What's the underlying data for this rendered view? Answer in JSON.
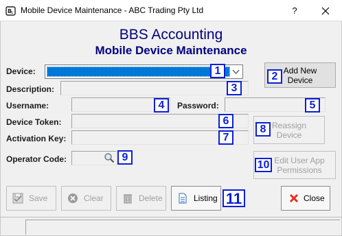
{
  "window": {
    "title": "Mobile Device Maintenance - ABC Trading Pty Ltd",
    "help_glyph": "?",
    "app_icon": "bbs-logo-icon"
  },
  "header": {
    "title": "BBS Accounting",
    "subtitle": "Mobile Device Maintenance"
  },
  "form": {
    "device_label": "Device:",
    "description_label": "Description:",
    "username_label": "Username:",
    "password_label": "Password:",
    "device_token_label": "Device Token:",
    "activation_key_label": "Activation Key:",
    "operator_code_label": "Operator Code:"
  },
  "buttons": {
    "add_new_device": "Add New Device",
    "reassign_device": "Reassign Device",
    "edit_user_app_permissions": "Edit User App Permissions"
  },
  "toolbar": {
    "save": "Save",
    "clear": "Clear",
    "delete": "Delete",
    "listing": "Listing",
    "close": "Close"
  },
  "callouts": [
    "1",
    "2",
    "3",
    "4",
    "5",
    "6",
    "7",
    "8",
    "9",
    "10",
    "11"
  ],
  "colors": {
    "heading": "#000080",
    "selection": "#0078d7",
    "callout": "#0a1fd6",
    "close_icon": "#e0301e"
  }
}
